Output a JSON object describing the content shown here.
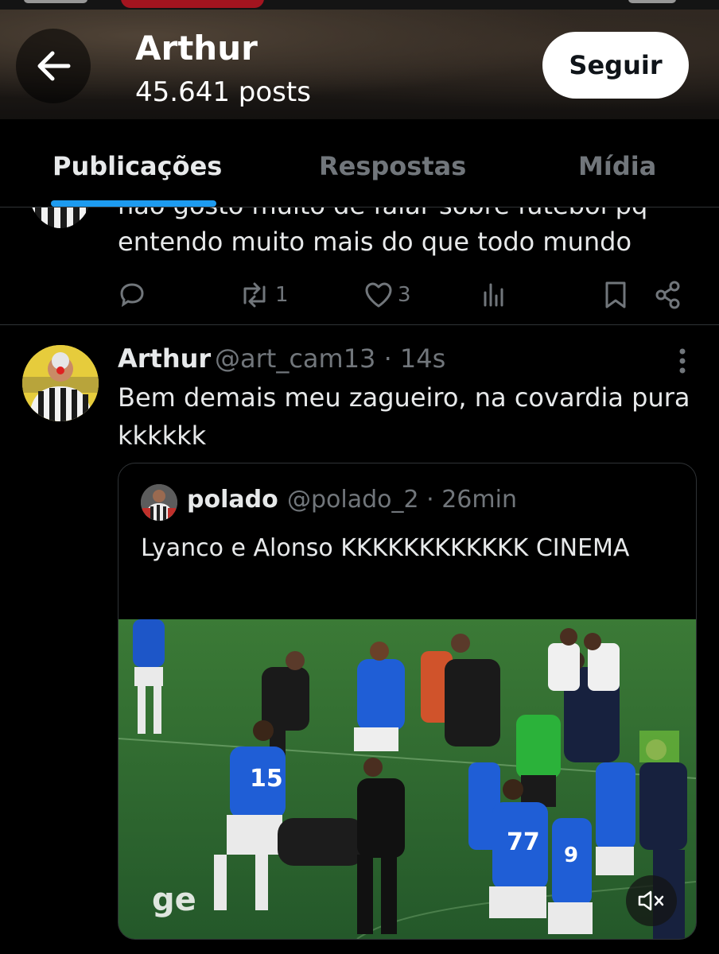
{
  "header": {
    "title": "Arthur",
    "subtitle": "45.641 posts",
    "follow_label": "Seguir"
  },
  "tabs": [
    {
      "label": "Publicações",
      "active": true
    },
    {
      "label": "Respostas",
      "active": false
    },
    {
      "label": "Mídia",
      "active": false
    }
  ],
  "prev_post": {
    "line1": "não gosto muito de falar sobre futebol pq",
    "line2": "entendo muito mais do que todo mundo",
    "retweets": "1",
    "likes": "3"
  },
  "post": {
    "author": "Arthur",
    "meta": "@art_cam13 · 14s",
    "text": "Bem demais meu zagueiro, na covardia pura kkkkkk",
    "quote": {
      "author": "polado",
      "meta": "@polado_2 · 26min",
      "text": "Lyanco e Alonso KKKKKKKKKKKK CINEMA",
      "media_logo": "ge"
    }
  },
  "icons": [
    "back-arrow-icon",
    "reply-icon",
    "retweet-icon",
    "like-icon",
    "views-icon",
    "bookmark-icon",
    "share-icon",
    "more-icon",
    "mute-icon"
  ],
  "colors": {
    "accent": "#1d9bf0",
    "muted_text": "#71767b",
    "background": "#000000"
  }
}
